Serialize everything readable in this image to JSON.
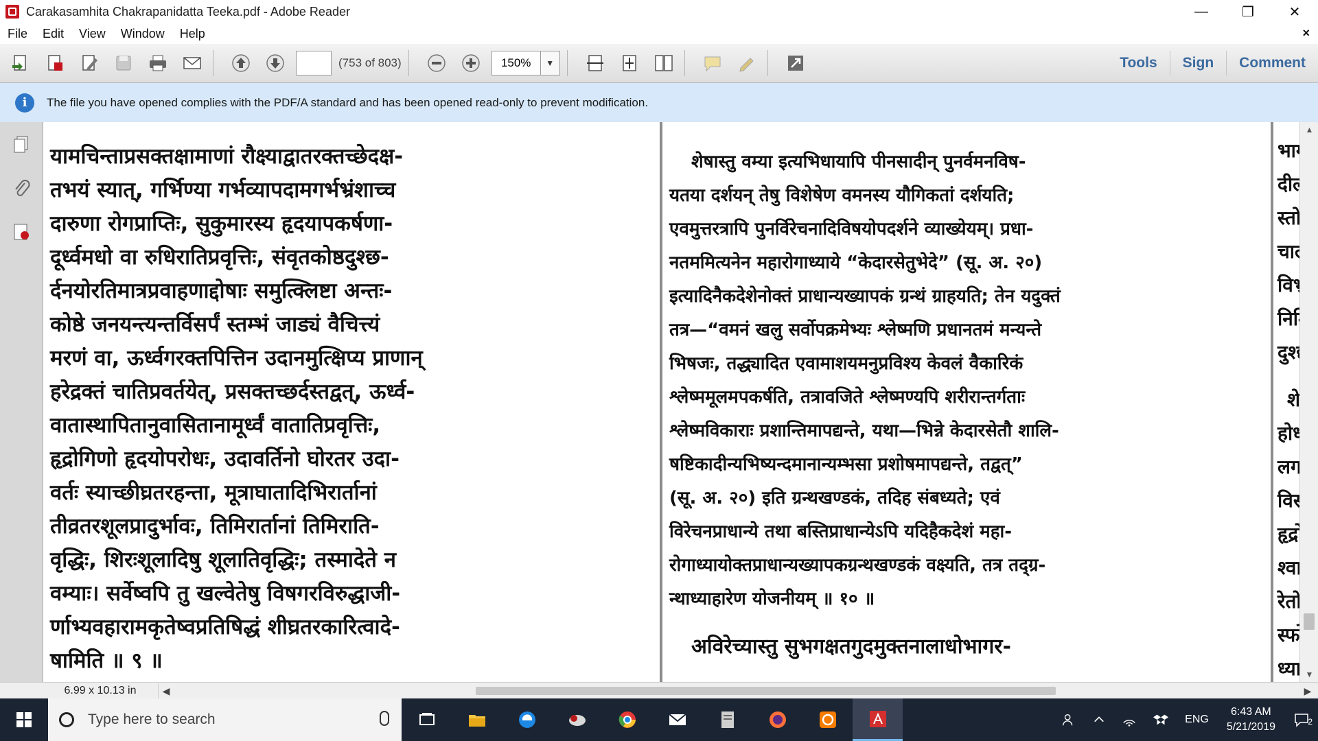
{
  "window": {
    "title": "Carakasamhita Chakrapanidatta Teeka.pdf - Adobe Reader",
    "minimize": "—",
    "restore": "❐",
    "close": "✕"
  },
  "menu": {
    "items": [
      "File",
      "Edit",
      "View",
      "Window",
      "Help"
    ],
    "close": "×"
  },
  "toolbar": {
    "page_input": "",
    "page_count": "(753 of 803)",
    "zoom": "150%",
    "tools": "Tools",
    "sign": "Sign",
    "comment": "Comment"
  },
  "infobar": {
    "icon": "i",
    "text": "The file you have opened complies with the PDF/A standard and has been opened read-only to prevent modification."
  },
  "document": {
    "left_page_lines": [
      "यामचिन्ताप्रसक्तक्षामाणां रौक्ष्याद्वातरक्तच्छेदक्ष-",
      "तभयं स्यात्, गर्भिण्या गर्भव्यापदामगर्भभ्रंशाच्च",
      "दारुणा रोगप्राप्तिः, सुकुमारस्य हृदयापकर्षणा-",
      "दूर्ध्वमधो वा रुधिरातिप्रवृत्तिः, संवृतकोष्ठदुश्छ-",
      "र्दनयोरतिमात्रप्रवाहणाद्दोषाः समुत्क्लिष्टा अन्तः-",
      "कोष्ठे जनयन्त्यन्तर्विसर्पं स्तम्भं जाड्यं वैचित्त्यं",
      "मरणं वा, ऊर्ध्वगरक्तपित्तिन उदानमुत्क्षिप्य प्राणान्",
      "हरेद्रक्तं चातिप्रवर्तयेत्, प्रसक्तच्छर्दस्तद्वत्, ऊर्ध्व-",
      "वातास्थापितानुवासितानामूर्ध्वं वातातिप्रवृत्तिः,",
      "हृद्रोगिणो हृदयोपरोधः, उदावर्तिनो घोरतर उदा-",
      "वर्तः स्याच्छीघ्रतरहन्ता, मूत्राघातादिभिरार्तानां",
      "तीव्रतरशूलप्रादुर्भावः, तिमिरार्तानां तिमिराति-",
      "वृद्धिः, शिरःशूलादिषु शूलातिवृद्धिः; तस्मादेते न",
      "वम्याः। सर्वेष्वपि तु खल्वेतेषु विषगरविरुद्धाजी-",
      "र्णाभ्यवहारामकृतेष्वप्रतिषिद्धं शीघ्रतरकारित्वादे-",
      "षामिति ॥ ९ ॥"
    ],
    "center_page_lines": [
      "शेषास्तु वम्या इत्यभिधायापि पीनसादीन् पुनर्वमनविष-",
      "यतया दर्शयन् तेषु विशेषेण वमनस्य यौगिकतां दर्शयति;",
      "एवमुत्तरत्रापि पुनर्विरेचनादिविषयोपदर्शने व्याख्येयम्। प्रधा-",
      "नतममित्यनेन महारोगाध्याये “केदारसेतुभेदे” (सू. अ. २०)",
      "इत्यादिनैकदेशेनोक्तं प्राधान्यख्यापकं ग्रन्थं ग्राहयति; तेन यदुक्तं",
      "तत्र—“वमनं खलु सर्वोपक्रमेभ्यः श्लेष्मणि प्रधानतमं मन्यन्ते",
      "भिषजः, तद्ध्यादित एवामाशयमनुप्रविश्य केवलं वैकारिकं",
      "श्लेष्ममूलमपकर्षति, तत्रावजिते श्लेष्मण्यपि शरीरान्तर्गताः",
      "श्लेष्मविकाराः प्रशान्तिमापद्यन्ते, यथा—भिन्ने केदारसेतौ शालि-",
      "षष्टिकादीन्यभिष्यन्दमानान्यम्भसा प्रशोषमापद्यन्ते, तद्वत्”",
      "(सू. अ. २०) इति ग्रन्थखण्डकं, तदिह संबध्यते; एवं",
      "विरेचनप्राधान्ये तथा बस्तिप्राधान्येऽपि यदिहैकदेशं महा-",
      "रोगाध्यायोक्तप्राधान्यख्यापकग्रन्थखण्डकं वक्ष्यति, तत्र तद्ग्र-",
      "न्थाध्याहारेण योजनीयम् ॥ १० ॥",
      "अविरेच्यास्तु सुभगक्षतगुदमुक्तनालाधोभागर-"
    ],
    "right_page_lines": [
      "भागरक्त",
      "दीलादि",
      "स्तोकप्र",
      "चाल्पं व",
      "विभ्रंशि",
      "निमित्तं",
      "दुश्छर्दन",
      "शेष",
      "होध्वंस",
      "लगण्ड",
      "विसर्प",
      "हृद्रोग",
      "श्वासक",
      "रेतोदो",
      "स्फोट",
      "ध्यायो"
    ]
  },
  "statusbar": {
    "page_size": "6.99 x 10.13 in"
  },
  "taskbar": {
    "search_placeholder": "Type here to search",
    "language": "ENG",
    "time": "6:43 AM",
    "date": "5/21/2019",
    "notification_count": "2"
  }
}
